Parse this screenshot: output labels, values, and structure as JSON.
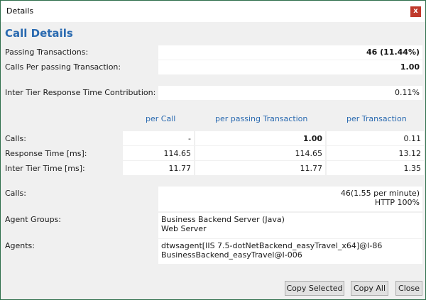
{
  "window": {
    "title": "Details",
    "close_glyph": "x"
  },
  "heading": "Call Details",
  "summary": [
    {
      "label": "Passing Transactions:",
      "value": "46 (11.44%)"
    },
    {
      "label": "Calls Per passing Transaction:",
      "value": "1.00"
    },
    {
      "label": "Inter Tier Response Time Contribution:",
      "value": "0.11%"
    }
  ],
  "table": {
    "columns": [
      "per Call",
      "per passing Transaction",
      "per Transaction"
    ],
    "rows": [
      {
        "label": "Calls:",
        "values": [
          "-",
          "1.00",
          "0.11"
        ]
      },
      {
        "label": "Response Time [ms]:",
        "values": [
          "114.65",
          "114.65",
          "13.12"
        ]
      },
      {
        "label": "Inter Tier Time [ms]:",
        "values": [
          "11.77",
          "11.77",
          "1.35"
        ]
      }
    ]
  },
  "details": {
    "calls_label": "Calls:",
    "calls_value_1": "46(1.55 per minute)",
    "calls_value_2": "HTTP 100%",
    "agent_groups_label": "Agent Groups:",
    "agent_groups": [
      "Business Backend Server (Java)",
      "Web Server"
    ],
    "agents_label": "Agents:",
    "agents": [
      "dtwsagent[IIS 7.5-dotNetBackend_easyTravel_x64]@I-86",
      "BusinessBackend_easyTravel@I-006"
    ]
  },
  "buttons": {
    "copy_selected": "Copy Selected",
    "copy_all": "Copy All",
    "close": "Close"
  },
  "colors": {
    "accent": "#2a6ab0",
    "close_bg": "#c0392b",
    "border": "#2d6e4a"
  }
}
